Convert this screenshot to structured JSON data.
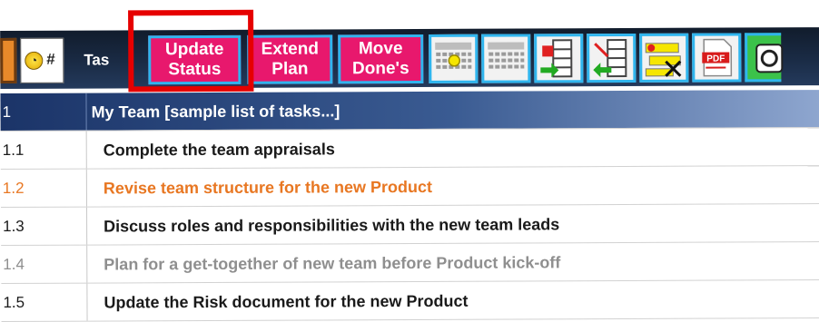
{
  "toolbar": {
    "status_symbol": "#",
    "task_header": "Tas",
    "buttons": [
      {
        "line1": "Update",
        "line2": "Status"
      },
      {
        "line1": "Extend",
        "line2": "Plan"
      },
      {
        "line1": "Move",
        "line2": "Done's"
      }
    ],
    "icons": [
      "calendar-today-icon",
      "calendar-week-icon",
      "import-list-icon",
      "export-list-icon",
      "clear-highlight-icon",
      "pdf-icon",
      "timer-icon"
    ],
    "pdf_label": "PDF"
  },
  "rows": [
    {
      "num": "1",
      "title": "My Team [sample list of tasks...]",
      "kind": "group"
    },
    {
      "num": "1.1",
      "title": "Complete the team appraisals",
      "color": "black"
    },
    {
      "num": "1.2",
      "title": "Revise team structure for the new Product",
      "color": "orange"
    },
    {
      "num": "1.3",
      "title": "Discuss roles and responsibilities with the new team leads",
      "color": "black"
    },
    {
      "num": "1.4",
      "title": "Plan for a get-together of new team before Product kick-off",
      "color": "gray"
    },
    {
      "num": "1.5",
      "title": "Update the Risk document for the new Product",
      "color": "black"
    }
  ],
  "colors": {
    "button_pink": "#e8186d",
    "button_border": "#2fb5ee",
    "highlight_red": "#e60000",
    "header_navy": "#1a2b45",
    "task_orange": "#e87722",
    "task_gray": "#8f8f8f"
  }
}
